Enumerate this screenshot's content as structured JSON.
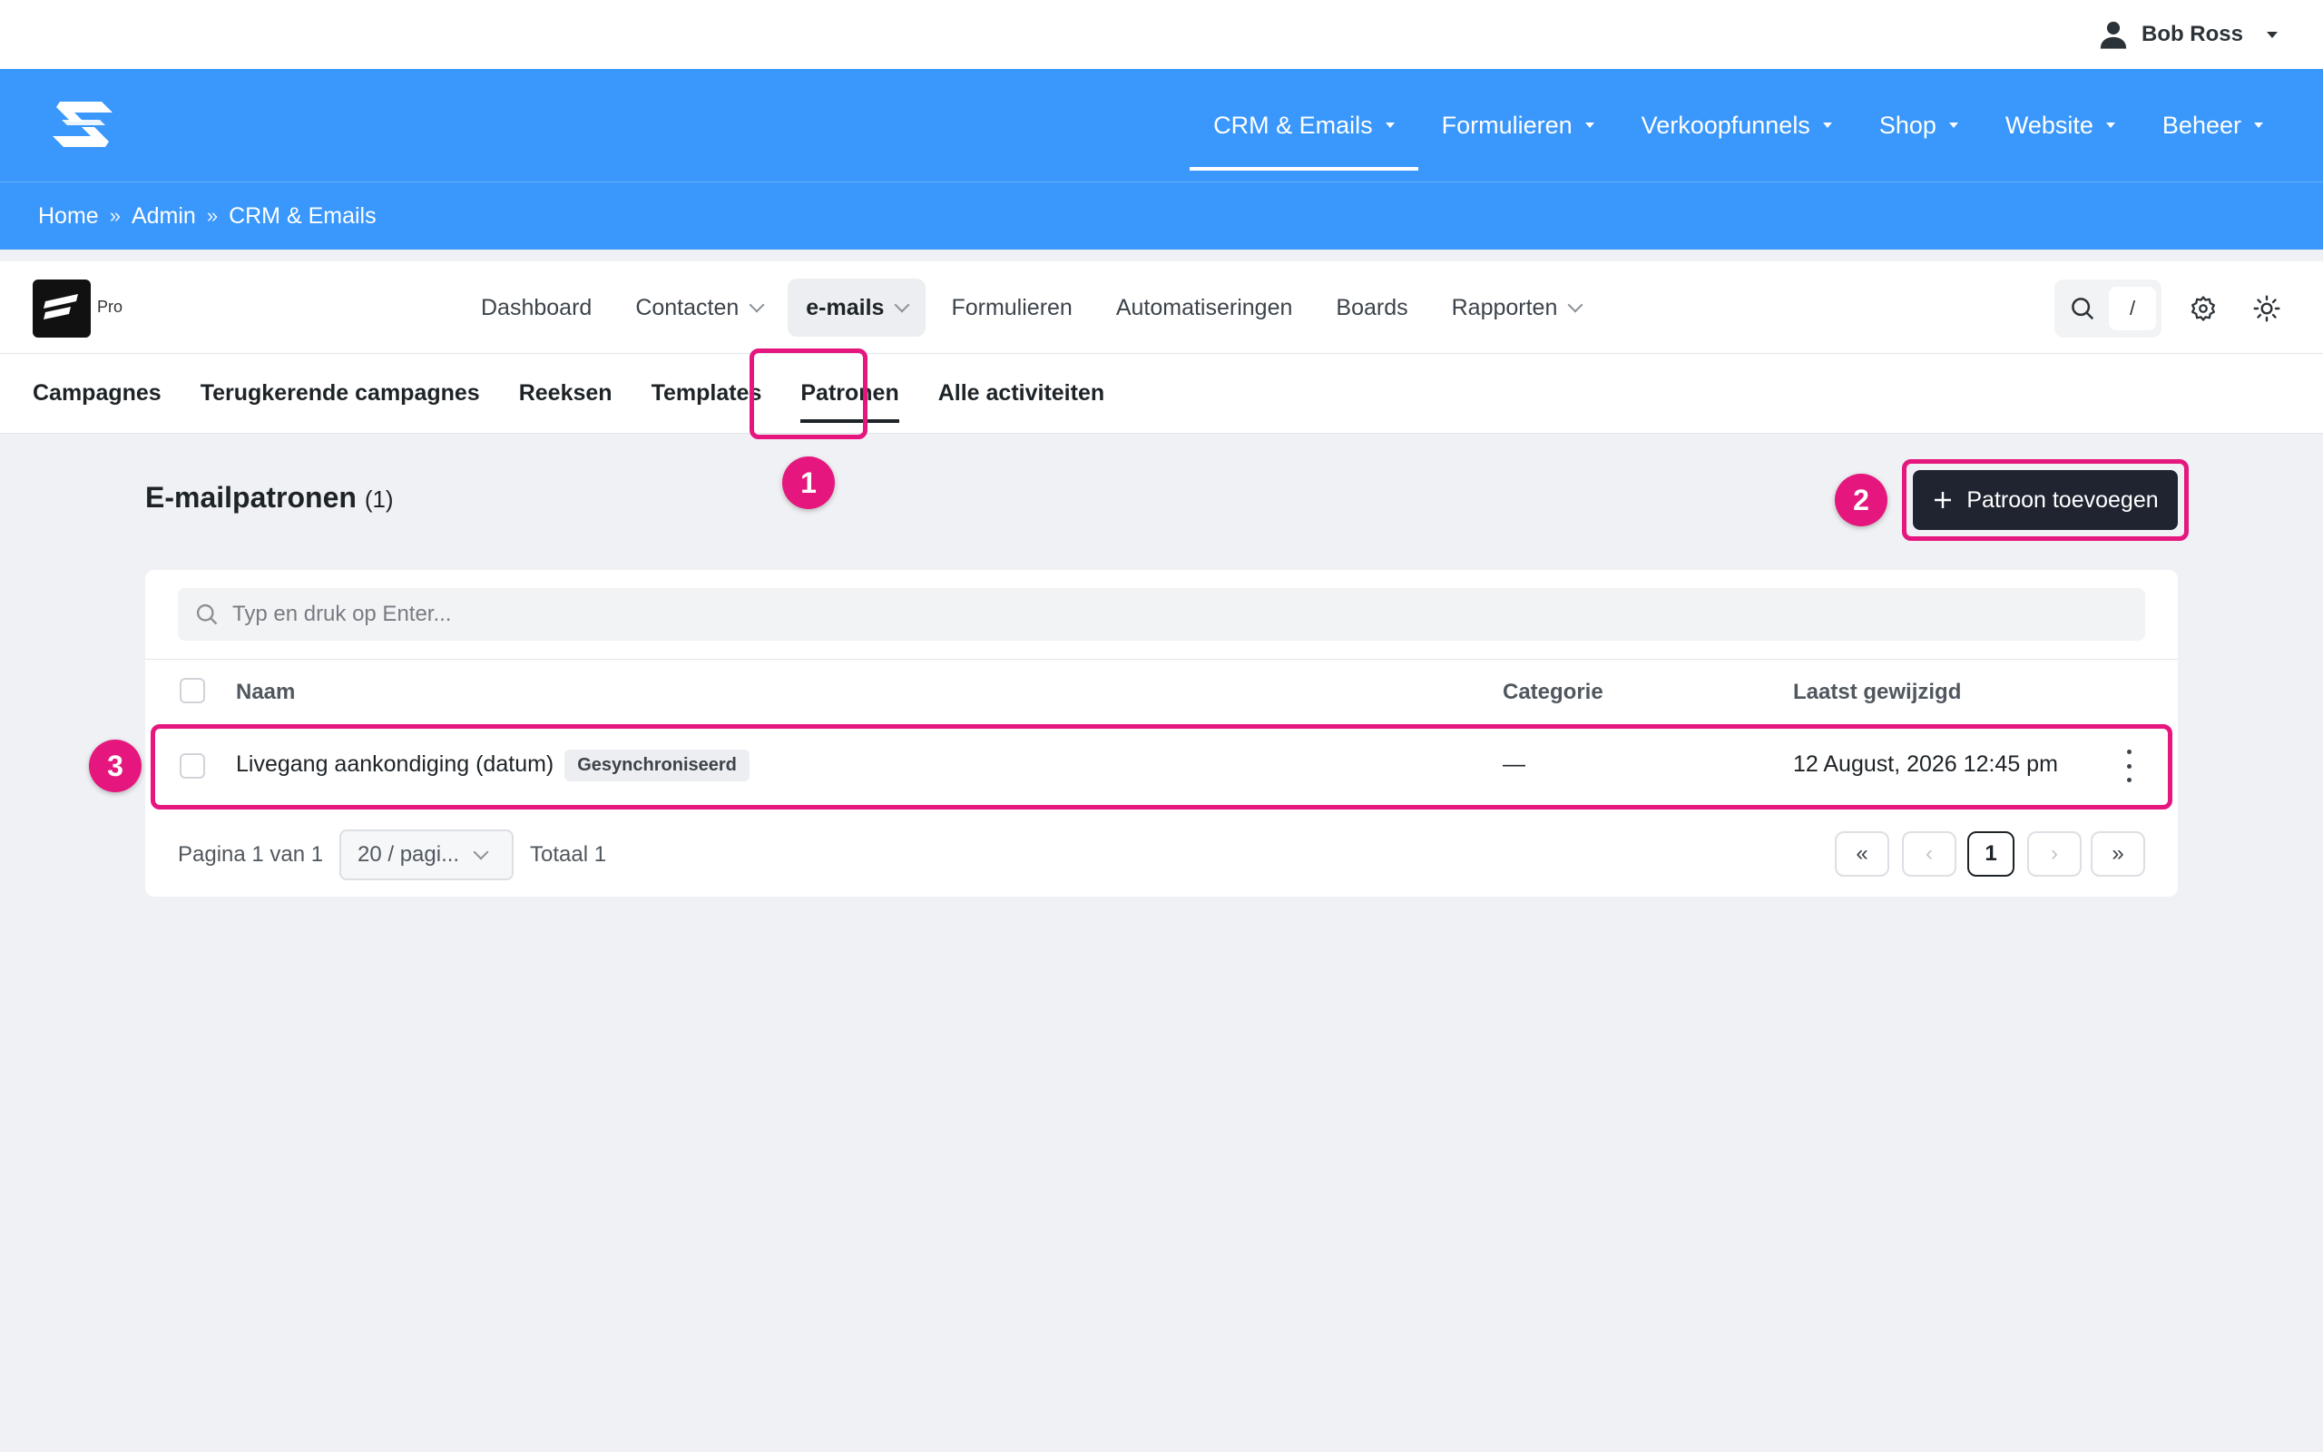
{
  "topbar": {
    "user_name": "Bob Ross"
  },
  "main_nav": {
    "items": [
      {
        "label": "CRM & Emails"
      },
      {
        "label": "Formulieren"
      },
      {
        "label": "Verkoopfunnels"
      },
      {
        "label": "Shop"
      },
      {
        "label": "Website"
      },
      {
        "label": "Beheer"
      }
    ]
  },
  "breadcrumb": {
    "items": [
      "Home",
      "Admin",
      "CRM & Emails"
    ],
    "separator": "»"
  },
  "app_header": {
    "pro_label": "Pro",
    "tabs": [
      {
        "label": "Dashboard"
      },
      {
        "label": "Contacten"
      },
      {
        "label": "e-mails"
      },
      {
        "label": "Formulieren"
      },
      {
        "label": "Automatiseringen"
      },
      {
        "label": "Boards"
      },
      {
        "label": "Rapporten"
      }
    ],
    "search_shortcut": "/"
  },
  "sub_tabs": [
    "Campagnes",
    "Terugkerende campagnes",
    "Reeksen",
    "Templates",
    "Patronen",
    "Alle activiteiten"
  ],
  "page": {
    "title": "E-mailpatronen",
    "count": "(1)",
    "add_button": "Patroon toevoegen",
    "search_placeholder": "Typ en druk op Enter..."
  },
  "table": {
    "columns": [
      "Naam",
      "Categorie",
      "Laatst gewijzigd"
    ],
    "rows": [
      {
        "name": "Livegang aankondiging (datum)",
        "tag": "Gesynchroniseerd",
        "category": "—",
        "modified": "12 August, 2026 12:45 pm"
      }
    ]
  },
  "pager": {
    "page_info": "Pagina 1 van 1",
    "page_size": "20 / pagi...",
    "total": "Totaal 1",
    "current_page": "1",
    "first": "«",
    "prev": "‹",
    "next": "›",
    "last": "»"
  },
  "annotations": [
    "1",
    "2",
    "3"
  ],
  "colors": {
    "nav_blue": "#3a97fb",
    "highlight": "#e5177e",
    "button_dark": "#1f2430"
  }
}
